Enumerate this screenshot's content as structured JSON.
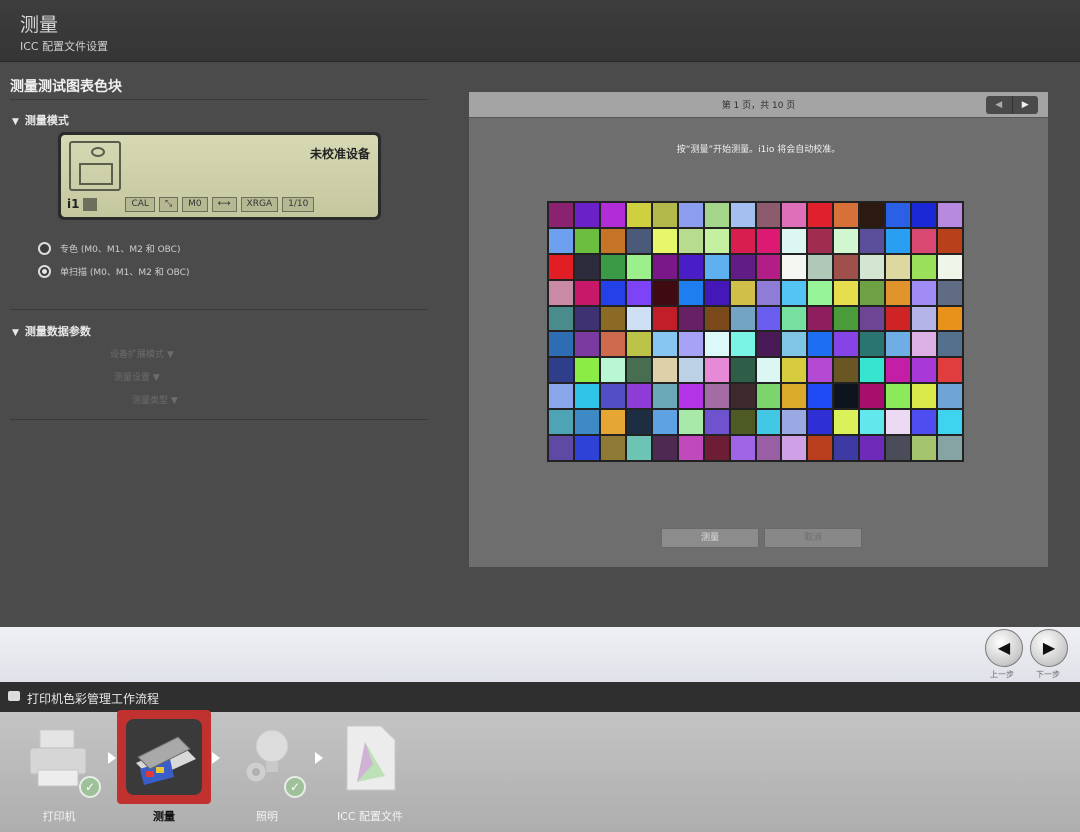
{
  "header": {
    "title": "测量",
    "subtitle": "ICC 配置文件设置"
  },
  "left": {
    "section_title": "测量测试图表色块",
    "mode_group": "测量模式",
    "device_lcd": {
      "status": "未校准设备",
      "logo": "i1",
      "chips": [
        "CAL",
        "M0",
        "XRGA",
        "1/10"
      ]
    },
    "radio_options": [
      {
        "label": "专色 (M0、M1、M2 和 OBC)",
        "selected": false
      },
      {
        "label": "单扫描 (M0、M1、M2 和 OBC)",
        "selected": true
      }
    ],
    "params_group": "测量数据参数",
    "param_rows": [
      "设备扩展模式",
      "测量设置",
      "测量类型"
    ]
  },
  "right": {
    "page_label": "第 1 页，共 10 页",
    "pager_prev": "◀",
    "pager_next": "▶",
    "instruction": "按“测量”开始测量。i1io 将会自动校准。",
    "measure_button": "测量",
    "cancel_button": "取消",
    "patch_colors": [
      "#8b2270",
      "#6a22c8",
      "#b12dd8",
      "#cfd040",
      "#b3b84a",
      "#8d9ef0",
      "#a3d58a",
      "#a3c0f0",
      "#8d5a6e",
      "#df6fb8",
      "#e0202c",
      "#d8703a",
      "#2c1a10",
      "#2a5fe6",
      "#1a28d6",
      "#b78ae0",
      "#6ea0f0",
      "#6bbe40",
      "#c67426",
      "#4a5a78",
      "#e8f66a",
      "#b8dc8e",
      "#c4f0a0",
      "#d81e4e",
      "#dc1a74",
      "#dcf6f2",
      "#a02c50",
      "#d2f6d0",
      "#5a4e9a",
      "#2a9ef2",
      "#d84870",
      "#b8401a",
      "#e01e24",
      "#2c2c3c",
      "#3a9a46",
      "#9cf08c",
      "#7a188a",
      "#4a1ec6",
      "#5eb0f0",
      "#621c86",
      "#b21e86",
      "#f4f6f2",
      "#b0c8b8",
      "#a0504a",
      "#d4e6d2",
      "#dcd8a0",
      "#9ae05a",
      "#eef6ea",
      "#c88aa4",
      "#c8186a",
      "#2440e8",
      "#7c44f6",
      "#400a12",
      "#1e7ef0",
      "#4418b8",
      "#d0c04a",
      "#8e7cd6",
      "#54c4f4",
      "#98f498",
      "#e6de4c",
      "#6ea044",
      "#e2942c",
      "#a08cf4",
      "#606c84",
      "#4a8c8c",
      "#3e3272",
      "#8a6a24",
      "#d0e0f4",
      "#c21e2a",
      "#682064",
      "#7a4a1a",
      "#74a4c4",
      "#6a5ef0",
      "#76e0a0",
      "#8e1e5e",
      "#4a9c3a",
      "#6e4494",
      "#ce2426",
      "#b4b4e8",
      "#e8921c",
      "#2e6cb4",
      "#7a3aa0",
      "#ce6a4e",
      "#bcc448",
      "#86c6f0",
      "#a7a2f6",
      "#dcf8f8",
      "#7af4e4",
      "#4a1a56",
      "#7ec6e4",
      "#1e6ef4",
      "#8644e6",
      "#2a7472",
      "#6eaee4",
      "#dcb0e4",
      "#54708c",
      "#2e3e8a",
      "#8aec44",
      "#b8f6d4",
      "#486e52",
      "#ded0a8",
      "#bcd0e6",
      "#e68ad8",
      "#2e5e48",
      "#dcf6f4",
      "#d6cc3e",
      "#b44ad4",
      "#6a5624",
      "#36e4d0",
      "#c41ea6",
      "#a838d8",
      "#e03e3e",
      "#88a6e8",
      "#2ec4e8",
      "#524ec6",
      "#8e3cd8",
      "#6aaab8",
      "#b234e6",
      "#a46ca4",
      "#3e2a2e",
      "#7cd46c",
      "#daaa2a",
      "#1e4af4",
      "#0e141e",
      "#a80e6c",
      "#8cea5a",
      "#daea4a",
      "#6ea4d6",
      "#4ea4b4",
      "#3e8ac4",
      "#e6a634",
      "#1e2e42",
      "#5ea2e4",
      "#a8e8a8",
      "#6e52ce",
      "#4e5a24",
      "#42c8e4",
      "#9aa8e4",
      "#2e30d6",
      "#dcf05a",
      "#62e8ec",
      "#ecdaf4",
      "#4e4ef0",
      "#3ed4f0",
      "#5e4aa4",
      "#2e42d8",
      "#8e7a34",
      "#6ec4b4",
      "#4e2a52",
      "#c04abc",
      "#6e1e34",
      "#a064e6",
      "#9a5ea4",
      "#d0a0e6",
      "#b83e1e",
      "#3e3aa4",
      "#6e2ab8",
      "#4a4c5a",
      "#a4c46e",
      "#86a4a4"
    ],
    "patch_columns": 16
  },
  "nav": {
    "back_label": "上一步",
    "next_label": "下一步"
  },
  "workflow": {
    "title": "打印机色彩管理工作流程",
    "steps": [
      {
        "label": "打印机",
        "completed": true,
        "active": false
      },
      {
        "label": "测量",
        "completed": false,
        "active": true
      },
      {
        "label": "照明",
        "completed": true,
        "active": false
      },
      {
        "label": "ICC 配置文件",
        "completed": false,
        "active": false
      }
    ]
  }
}
